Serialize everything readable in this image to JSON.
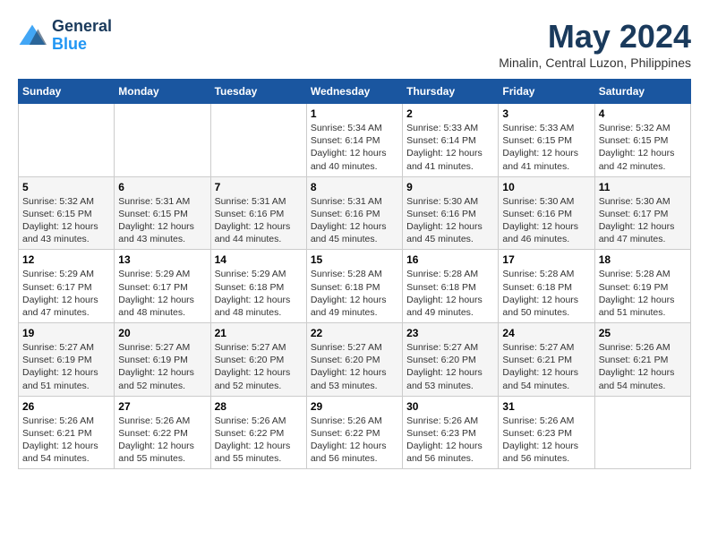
{
  "header": {
    "logo_line1": "General",
    "logo_line2": "Blue",
    "month_title": "May 2024",
    "location": "Minalin, Central Luzon, Philippines"
  },
  "weekdays": [
    "Sunday",
    "Monday",
    "Tuesday",
    "Wednesday",
    "Thursday",
    "Friday",
    "Saturday"
  ],
  "weeks": [
    [
      {
        "day": "",
        "info": ""
      },
      {
        "day": "",
        "info": ""
      },
      {
        "day": "",
        "info": ""
      },
      {
        "day": "1",
        "info": "Sunrise: 5:34 AM\nSunset: 6:14 PM\nDaylight: 12 hours\nand 40 minutes."
      },
      {
        "day": "2",
        "info": "Sunrise: 5:33 AM\nSunset: 6:14 PM\nDaylight: 12 hours\nand 41 minutes."
      },
      {
        "day": "3",
        "info": "Sunrise: 5:33 AM\nSunset: 6:15 PM\nDaylight: 12 hours\nand 41 minutes."
      },
      {
        "day": "4",
        "info": "Sunrise: 5:32 AM\nSunset: 6:15 PM\nDaylight: 12 hours\nand 42 minutes."
      }
    ],
    [
      {
        "day": "5",
        "info": "Sunrise: 5:32 AM\nSunset: 6:15 PM\nDaylight: 12 hours\nand 43 minutes."
      },
      {
        "day": "6",
        "info": "Sunrise: 5:31 AM\nSunset: 6:15 PM\nDaylight: 12 hours\nand 43 minutes."
      },
      {
        "day": "7",
        "info": "Sunrise: 5:31 AM\nSunset: 6:16 PM\nDaylight: 12 hours\nand 44 minutes."
      },
      {
        "day": "8",
        "info": "Sunrise: 5:31 AM\nSunset: 6:16 PM\nDaylight: 12 hours\nand 45 minutes."
      },
      {
        "day": "9",
        "info": "Sunrise: 5:30 AM\nSunset: 6:16 PM\nDaylight: 12 hours\nand 45 minutes."
      },
      {
        "day": "10",
        "info": "Sunrise: 5:30 AM\nSunset: 6:16 PM\nDaylight: 12 hours\nand 46 minutes."
      },
      {
        "day": "11",
        "info": "Sunrise: 5:30 AM\nSunset: 6:17 PM\nDaylight: 12 hours\nand 47 minutes."
      }
    ],
    [
      {
        "day": "12",
        "info": "Sunrise: 5:29 AM\nSunset: 6:17 PM\nDaylight: 12 hours\nand 47 minutes."
      },
      {
        "day": "13",
        "info": "Sunrise: 5:29 AM\nSunset: 6:17 PM\nDaylight: 12 hours\nand 48 minutes."
      },
      {
        "day": "14",
        "info": "Sunrise: 5:29 AM\nSunset: 6:18 PM\nDaylight: 12 hours\nand 48 minutes."
      },
      {
        "day": "15",
        "info": "Sunrise: 5:28 AM\nSunset: 6:18 PM\nDaylight: 12 hours\nand 49 minutes."
      },
      {
        "day": "16",
        "info": "Sunrise: 5:28 AM\nSunset: 6:18 PM\nDaylight: 12 hours\nand 49 minutes."
      },
      {
        "day": "17",
        "info": "Sunrise: 5:28 AM\nSunset: 6:18 PM\nDaylight: 12 hours\nand 50 minutes."
      },
      {
        "day": "18",
        "info": "Sunrise: 5:28 AM\nSunset: 6:19 PM\nDaylight: 12 hours\nand 51 minutes."
      }
    ],
    [
      {
        "day": "19",
        "info": "Sunrise: 5:27 AM\nSunset: 6:19 PM\nDaylight: 12 hours\nand 51 minutes."
      },
      {
        "day": "20",
        "info": "Sunrise: 5:27 AM\nSunset: 6:19 PM\nDaylight: 12 hours\nand 52 minutes."
      },
      {
        "day": "21",
        "info": "Sunrise: 5:27 AM\nSunset: 6:20 PM\nDaylight: 12 hours\nand 52 minutes."
      },
      {
        "day": "22",
        "info": "Sunrise: 5:27 AM\nSunset: 6:20 PM\nDaylight: 12 hours\nand 53 minutes."
      },
      {
        "day": "23",
        "info": "Sunrise: 5:27 AM\nSunset: 6:20 PM\nDaylight: 12 hours\nand 53 minutes."
      },
      {
        "day": "24",
        "info": "Sunrise: 5:27 AM\nSunset: 6:21 PM\nDaylight: 12 hours\nand 54 minutes."
      },
      {
        "day": "25",
        "info": "Sunrise: 5:26 AM\nSunset: 6:21 PM\nDaylight: 12 hours\nand 54 minutes."
      }
    ],
    [
      {
        "day": "26",
        "info": "Sunrise: 5:26 AM\nSunset: 6:21 PM\nDaylight: 12 hours\nand 54 minutes."
      },
      {
        "day": "27",
        "info": "Sunrise: 5:26 AM\nSunset: 6:22 PM\nDaylight: 12 hours\nand 55 minutes."
      },
      {
        "day": "28",
        "info": "Sunrise: 5:26 AM\nSunset: 6:22 PM\nDaylight: 12 hours\nand 55 minutes."
      },
      {
        "day": "29",
        "info": "Sunrise: 5:26 AM\nSunset: 6:22 PM\nDaylight: 12 hours\nand 56 minutes."
      },
      {
        "day": "30",
        "info": "Sunrise: 5:26 AM\nSunset: 6:23 PM\nDaylight: 12 hours\nand 56 minutes."
      },
      {
        "day": "31",
        "info": "Sunrise: 5:26 AM\nSunset: 6:23 PM\nDaylight: 12 hours\nand 56 minutes."
      },
      {
        "day": "",
        "info": ""
      }
    ]
  ]
}
